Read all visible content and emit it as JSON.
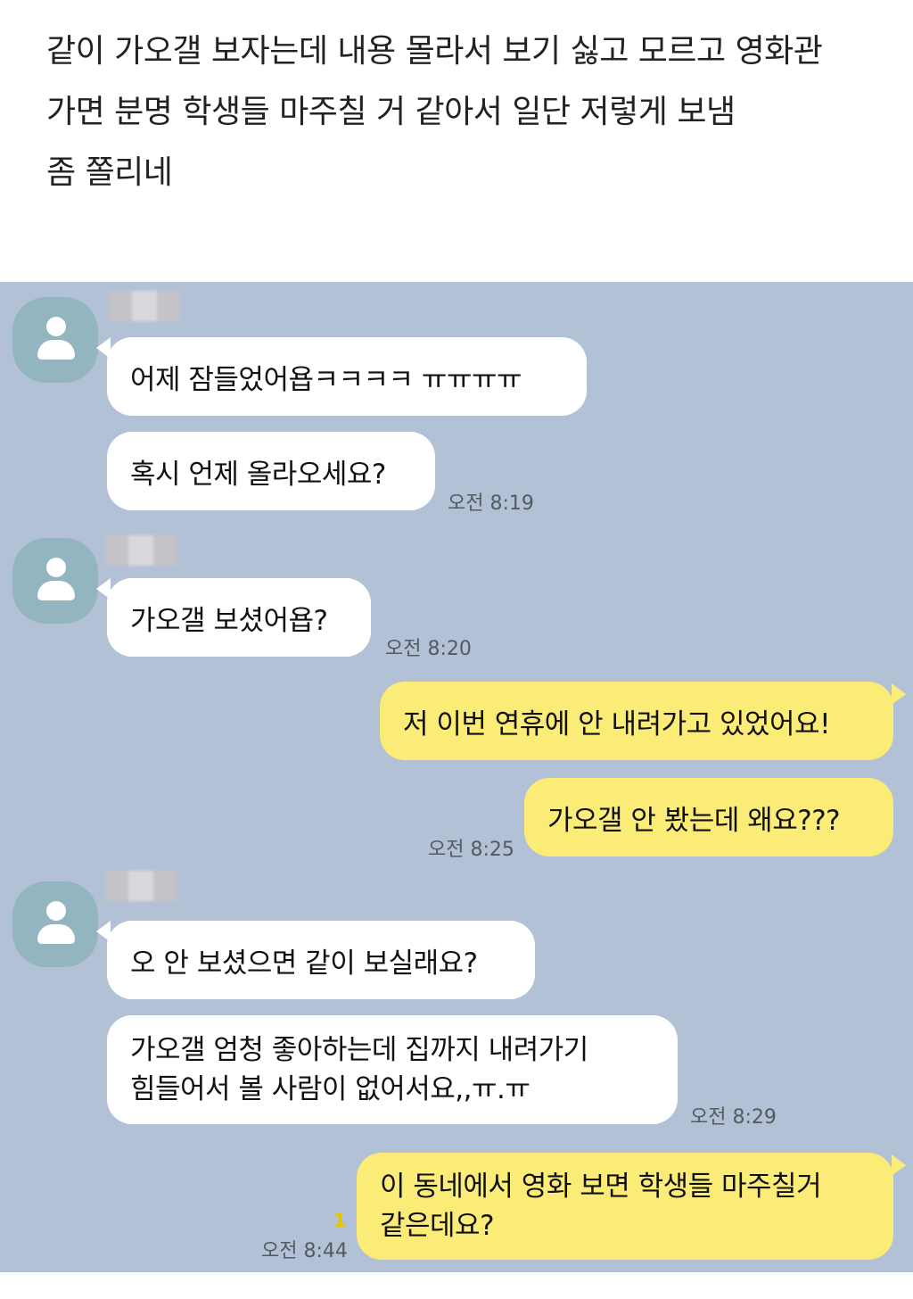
{
  "caption": {
    "lines": [
      "같이 가오갤 보자는데 내용 몰라서 보기 싫고 모르고 영화관",
      "가면 분명 학생들 마주칠 거 같아서 일단 저렇게 보냄",
      "좀 쫄리네"
    ]
  },
  "chat": {
    "background_color": "#b2c1d5",
    "my_bubble_color": "#fbeb77",
    "their_bubble_color": "#ffffff",
    "messages": [
      {
        "sender": "other",
        "text": "어제 잠들었어욥ㅋㅋㅋㅋ ㅠㅠㅠㅠ"
      },
      {
        "sender": "other",
        "text": "혹시 언제 올라오세요?",
        "time": "오전 8:19"
      },
      {
        "sender": "other",
        "text": "가오갤 보셨어욥?",
        "time": "오전 8:20"
      },
      {
        "sender": "me",
        "text": "저 이번 연휴에 안 내려가고 있었어요!"
      },
      {
        "sender": "me",
        "text": "가오갤 안 봤는데 왜요???",
        "time": "오전 8:25"
      },
      {
        "sender": "other",
        "text": "오 안 보셨으면 같이 보실래요?"
      },
      {
        "sender": "other",
        "text_line1": "가오갤 엄청 좋아하는데 집까지 내려가기",
        "text_line2": "힘들어서 볼 사람이 없어서요,,ㅠ.ㅠ",
        "time": "오전 8:29"
      },
      {
        "sender": "me",
        "text_line1": "이 동네에서 영화 보면 학생들 마주칠거",
        "text_line2": "같은데요?",
        "time": "오전 8:44",
        "unread": "1"
      }
    ]
  }
}
